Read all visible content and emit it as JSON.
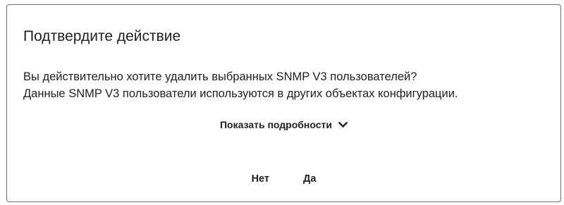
{
  "dialog": {
    "title": "Подтвердите действие",
    "message_line1": "Вы действительно хотите удалить выбранных SNMP V3 пользователей?",
    "message_line2": "Данные SNMP V3 пользователи используются в других объектах конфигурации.",
    "details_toggle_label": "Показать подробности",
    "details_icon": "chevron-down-icon",
    "buttons": {
      "no_label": "Нет",
      "yes_label": "Да"
    }
  }
}
